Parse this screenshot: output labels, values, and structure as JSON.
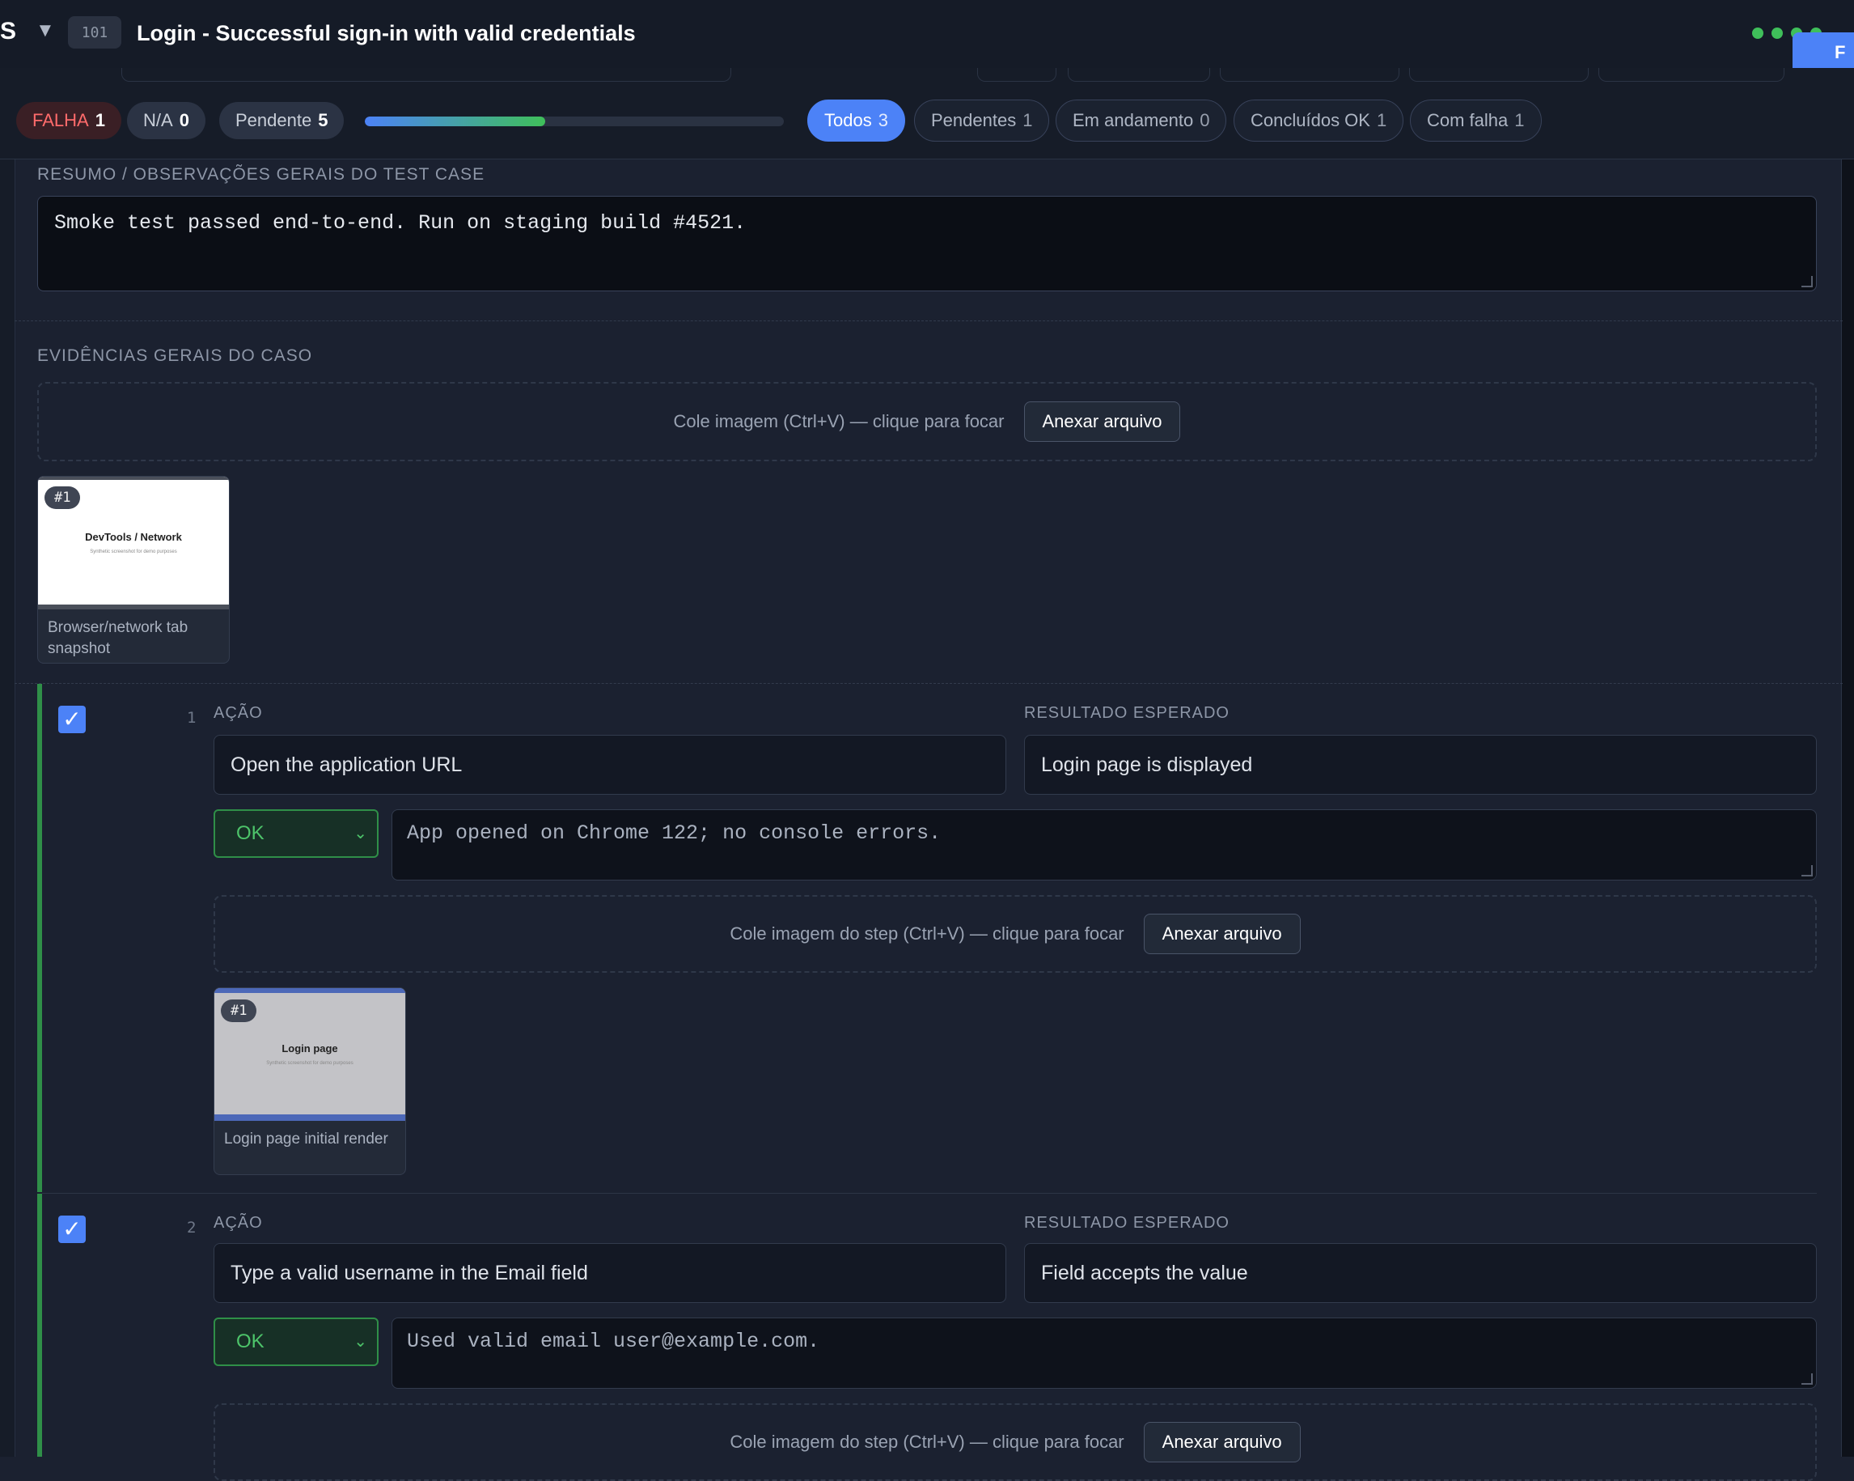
{
  "header": {
    "cut_letter": "S",
    "caret": "▼",
    "case_id": "101",
    "title": "Login - Successful sign-in with valid credentials",
    "cut_button_text": "F"
  },
  "status_chips": [
    {
      "label": "FALHA",
      "count": "1"
    },
    {
      "label": "N/A",
      "count": "0"
    },
    {
      "label": "Pendente",
      "count": "5"
    }
  ],
  "progress": {
    "fraction": 0.43
  },
  "filter_tabs": [
    {
      "label": "Todos",
      "count": "3",
      "active": true
    },
    {
      "label": "Pendentes",
      "count": "1",
      "active": false
    },
    {
      "label": "Em andamento",
      "count": "0",
      "active": false
    },
    {
      "label": "Concluídos OK",
      "count": "1",
      "active": false
    },
    {
      "label": "Com falha",
      "count": "1",
      "active": false
    }
  ],
  "summary": {
    "label": "RESUMO / OBSERVAÇÕES GERAIS DO TEST CASE",
    "value": "Smoke test passed end-to-end. Run on staging build #4521."
  },
  "case_evidence": {
    "label": "EVIDÊNCIAS GERAIS DO CASO",
    "paste_hint": "Cole imagem (Ctrl+V) — clique para focar",
    "attach_label": "Anexar arquivo",
    "thumbnails": [
      {
        "badge": "#1",
        "image_title": "DevTools / Network",
        "image_sub": "Synthetic screenshot for demo purposes",
        "caption": "Browser/network tab snapshot"
      }
    ]
  },
  "steps": [
    {
      "number": "1",
      "checked": true,
      "action_label": "AÇÃO",
      "expected_label": "RESULTADO ESPERADO",
      "action": "Open the application URL",
      "expected": "Login page is displayed",
      "status": "OK",
      "note": "App opened on Chrome 122; no console errors.",
      "paste_hint": "Cole imagem do step (Ctrl+V) — clique para focar",
      "attach_label": "Anexar arquivo",
      "thumbnails": [
        {
          "badge": "#1",
          "image_title": "Login page",
          "image_sub": "Synthetic screenshot for demo purposes",
          "caption": "Login page initial render"
        }
      ]
    },
    {
      "number": "2",
      "checked": true,
      "action_label": "AÇÃO",
      "expected_label": "RESULTADO ESPERADO",
      "action": "Type a valid username in the Email field",
      "expected": "Field accepts the value",
      "status": "OK",
      "note": "Used valid email user@example.com.",
      "paste_hint": "Cole imagem do step (Ctrl+V) — clique para focar",
      "attach_label": "Anexar arquivo"
    }
  ],
  "colors": {
    "accent": "#4c82f7",
    "ok": "#3fbf5a",
    "fail": "#ff6b6b",
    "background": "#1b2130"
  }
}
